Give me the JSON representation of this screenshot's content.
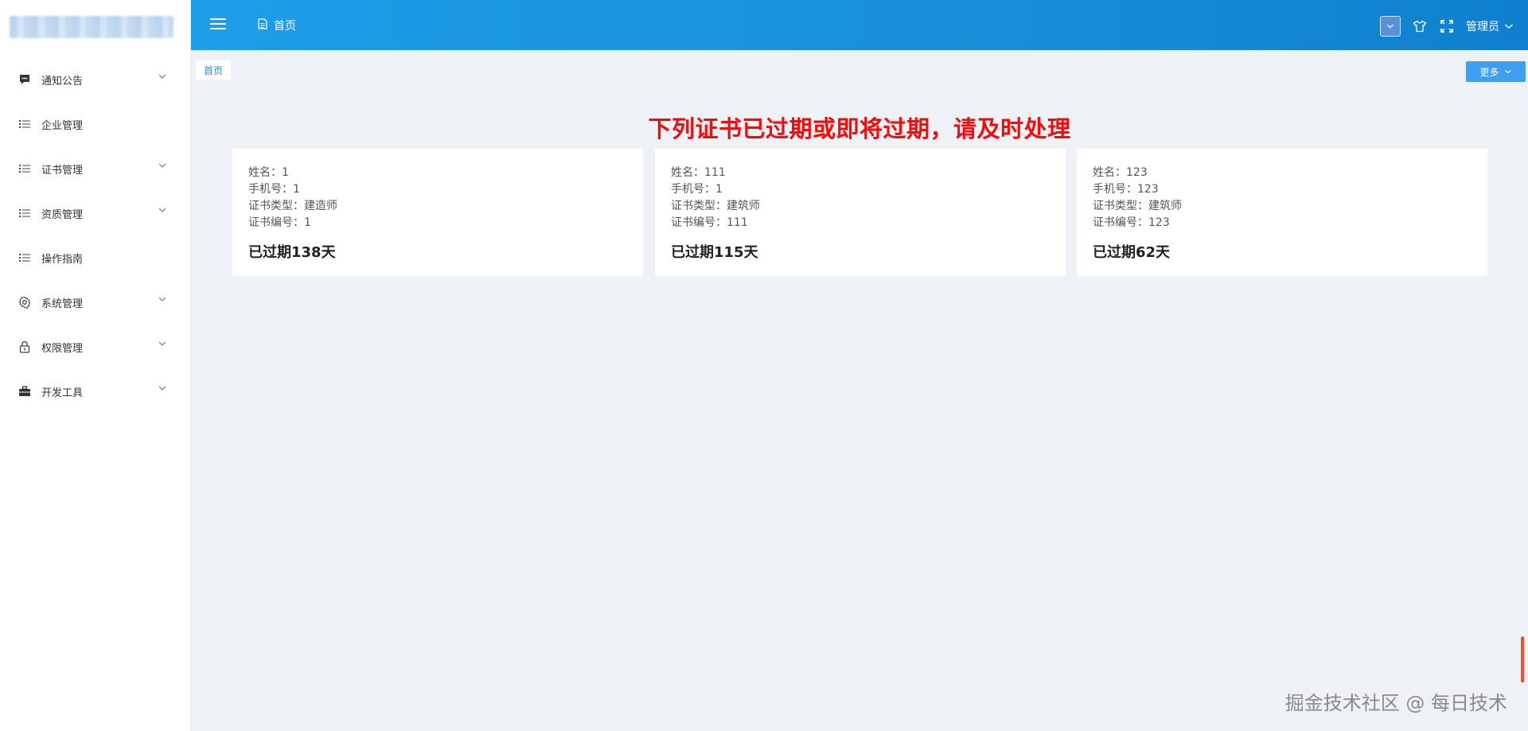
{
  "sidebar": {
    "items": [
      {
        "label": "通知公告",
        "icon": "message-icon",
        "has_children": true
      },
      {
        "label": "企业管理",
        "icon": "list-icon",
        "has_children": false
      },
      {
        "label": "证书管理",
        "icon": "list-icon",
        "has_children": true
      },
      {
        "label": "资质管理",
        "icon": "list-icon",
        "has_children": true
      },
      {
        "label": "操作指南",
        "icon": "list-icon",
        "has_children": false
      },
      {
        "label": "系统管理",
        "icon": "gear-icon",
        "has_children": true
      },
      {
        "label": "权限管理",
        "icon": "lock-icon",
        "has_children": true
      },
      {
        "label": "开发工具",
        "icon": "briefcase-icon",
        "has_children": true
      }
    ]
  },
  "header": {
    "tab_label": "首页",
    "user_name": "管理员"
  },
  "tabs": {
    "home_label": "首页",
    "more_label": "更多"
  },
  "main": {
    "title": "下列证书已过期或即将过期，请及时处理",
    "cards": [
      {
        "name": "姓名：1",
        "phone": "手机号：1",
        "type": "证书类型：建造师",
        "number": "证书编号：1",
        "status": "已过期138天"
      },
      {
        "name": "姓名：111",
        "phone": "手机号：1",
        "type": "证书类型：建筑师",
        "number": "证书编号：111",
        "status": "已过期115天"
      },
      {
        "name": "姓名：123",
        "phone": "手机号：123",
        "type": "证书类型：建筑师",
        "number": "证书编号：123",
        "status": "已过期62天"
      }
    ]
  },
  "watermark": "掘金技术社区 @ 每日技术",
  "colors": {
    "header_gradient_start": "#1e9de8",
    "header_gradient_end": "#0e80cf",
    "title_red": "#f20d0d",
    "tab_active": "#1f8fd9",
    "more_button": "#3e9ff0",
    "background": "#eef1f6"
  }
}
